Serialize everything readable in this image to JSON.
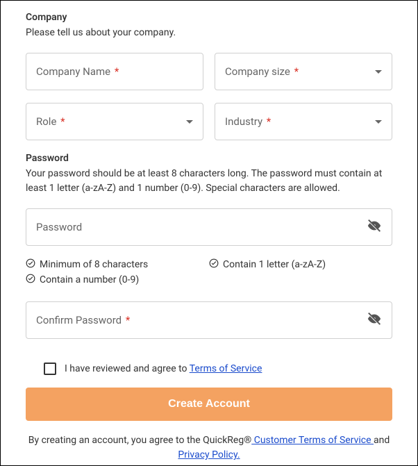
{
  "company": {
    "title": "Company",
    "desc": "Please tell us about your company.",
    "fields": {
      "name": {
        "label": "Company Name",
        "required": true
      },
      "size": {
        "label": "Company size",
        "required": true
      },
      "role": {
        "label": "Role",
        "required": true
      },
      "industry": {
        "label": "Industry",
        "required": true
      }
    }
  },
  "password": {
    "title": "Password",
    "desc": "Your password should be at least 8 characters long. The password must contain at least 1 letter (a-zA-Z) and 1 number (0-9). Special characters are allowed.",
    "field_label": "Password",
    "confirm_label": "Confirm Password",
    "confirm_required": true,
    "requirements": {
      "min": "Minimum of 8 characters",
      "letter": "Contain 1 letter (a-zA-Z)",
      "number": "Contain a number (0-9)"
    }
  },
  "terms": {
    "checkbox_prefix": "I have reviewed and agree to ",
    "tos_link": "Terms of Service"
  },
  "submit": {
    "label": "Create Account"
  },
  "footer": {
    "prefix": "By creating an account, you agree to the QuickReg®",
    "customer_terms": " Customer Terms of Service ",
    "and": "and",
    "privacy": " Privacy Policy."
  }
}
